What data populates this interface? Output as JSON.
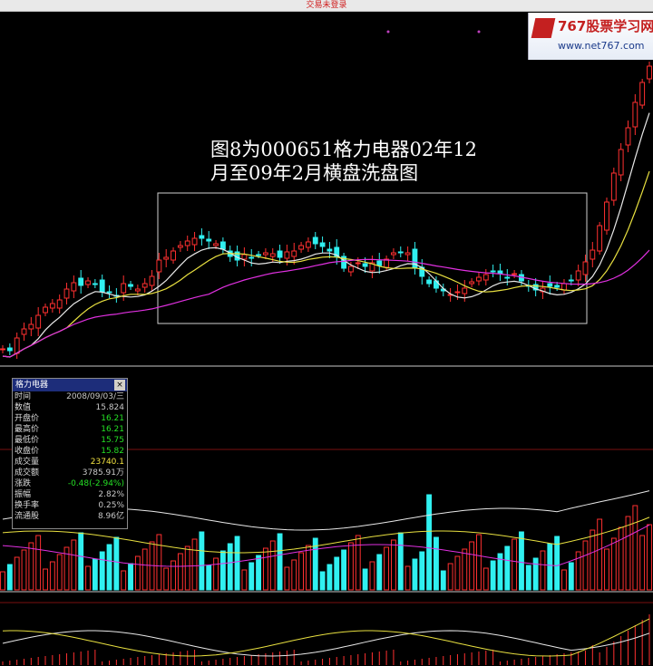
{
  "window": {
    "title": "交易未登录"
  },
  "watermark": {
    "title": "767股票学习网",
    "url": "www.net767.com"
  },
  "caption": {
    "line1": "图8为000651格力电器02年12",
    "line2": "月至09年2月横盘洗盘图"
  },
  "panel": {
    "title": "格力电器",
    "close_glyph": "×",
    "rows": [
      {
        "label": "时间",
        "value": "2008/09/03/三",
        "color": "gray"
      },
      {
        "label": "数值",
        "value": "15.824",
        "color": "gray"
      },
      {
        "label": "开盘价",
        "value": "16.21",
        "color": "green"
      },
      {
        "label": "最高价",
        "value": "16.21",
        "color": "green"
      },
      {
        "label": "最低价",
        "value": "15.75",
        "color": "green"
      },
      {
        "label": "收盘价",
        "value": "15.82",
        "color": "green"
      },
      {
        "label": "成交量",
        "value": "23740.1",
        "color": "yellow"
      },
      {
        "label": "成交额",
        "value": "3785.91万",
        "color": "gray"
      },
      {
        "label": "涨跌",
        "value": "-0.48(-2.94%)",
        "color": "green"
      },
      {
        "label": "振幅",
        "value": "2.82%",
        "color": "gray"
      },
      {
        "label": "换手率",
        "value": "0.25%",
        "color": "gray"
      },
      {
        "label": "流通股",
        "value": "8.96亿",
        "color": "gray"
      }
    ]
  },
  "colors": {
    "up": "#ff3030",
    "down": "#30f0f0",
    "ma_white": "#e8e8e8",
    "ma_yellow": "#e8e040",
    "ma_magenta": "#e030e0",
    "box": "#d0d0d0"
  }
}
